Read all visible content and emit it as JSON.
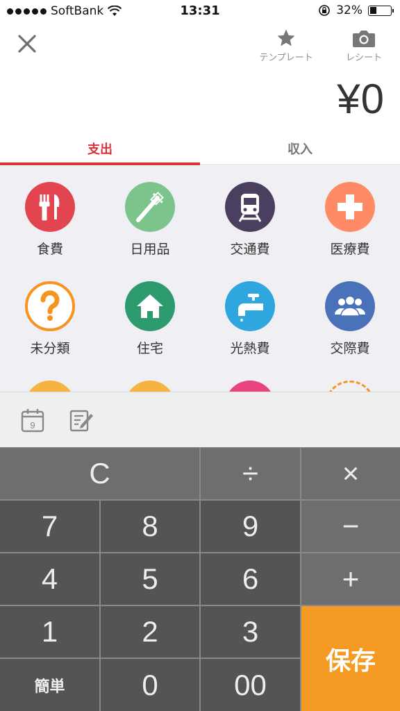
{
  "status_bar": {
    "carrier": "SoftBank",
    "time": "13:31",
    "battery": "32%"
  },
  "header": {
    "template_label": "テンプレート",
    "receipt_label": "レシート",
    "amount": "¥0"
  },
  "tabs": [
    {
      "label": "支出",
      "active": true
    },
    {
      "label": "収入",
      "active": false
    }
  ],
  "categories": [
    {
      "label": "食費",
      "icon": "fork-knife-icon",
      "color": "#e2454f"
    },
    {
      "label": "日用品",
      "icon": "toothbrush-icon",
      "color": "#7cc48b"
    },
    {
      "label": "交通費",
      "icon": "train-icon",
      "color": "#4a3f5e"
    },
    {
      "label": "医療費",
      "icon": "medical-cross-icon",
      "color": "#ff8a66"
    },
    {
      "label": "未分類",
      "icon": "question-icon",
      "color": "#f7931e"
    },
    {
      "label": "住宅",
      "icon": "house-icon",
      "color": "#2e9b6e"
    },
    {
      "label": "光熱費",
      "icon": "faucet-icon",
      "color": "#2fa6de"
    },
    {
      "label": "交際費",
      "icon": "people-icon",
      "color": "#4a72b8"
    }
  ],
  "memo_bar": {
    "date_icon_day": "9"
  },
  "keypad": {
    "clear": "C",
    "divide": "÷",
    "multiply": "×",
    "minus": "−",
    "plus": "+",
    "digits": [
      "7",
      "8",
      "9",
      "4",
      "5",
      "6",
      "1",
      "2",
      "3"
    ],
    "simple": "簡単",
    "zero": "0",
    "double_zero": "00",
    "save": "保存"
  },
  "colors": {
    "accent": "#d8343a",
    "save": "#f59b23"
  }
}
